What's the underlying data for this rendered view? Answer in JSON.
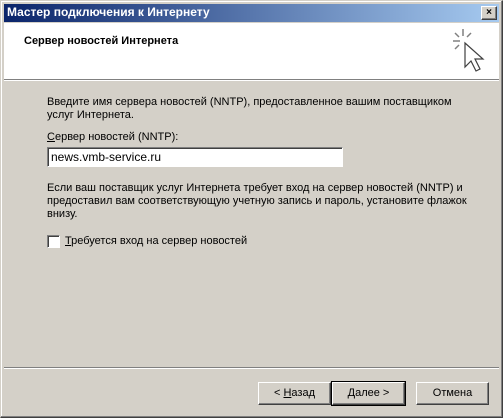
{
  "window": {
    "title": "Мастер подключения к Интернету",
    "close_glyph": "×"
  },
  "header": {
    "title": "Сервер новостей Интернета",
    "icon": "wizard-sparkle-cursor-icon"
  },
  "body": {
    "intro": "Введите имя сервера новостей (NNTP), предоставленное вашим поставщиком услуг Интернета.",
    "field_label_first": "С",
    "field_label_rest": "ервер новостей (NNTP):",
    "field_value": "news.vmb-service.ru",
    "note": "Если ваш поставщик услуг Интернета требует вход на сервер новостей (NNTP) и предоставил вам соответствующую учетную запись и пароль, установите флажок внизу.",
    "checkbox_label_first": "Т",
    "checkbox_label_rest": "ребуется вход на сервер новостей",
    "checkbox_checked": false
  },
  "buttons": {
    "back_prefix": "< ",
    "back_accel": "Н",
    "back_rest": "азад",
    "next_accel": "Д",
    "next_rest": "алее >",
    "cancel": "Отмена"
  }
}
